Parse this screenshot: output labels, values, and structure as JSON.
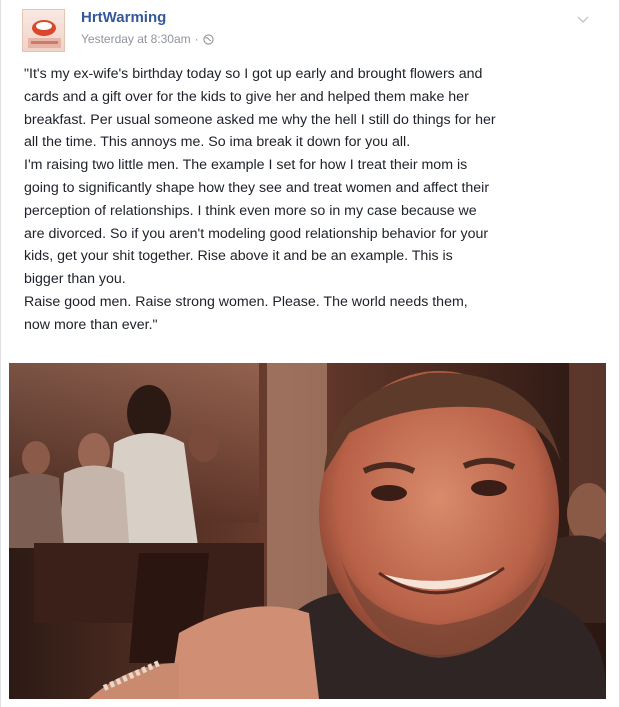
{
  "post": {
    "author": "HrtWarming",
    "timestamp": "Yesterday at 8:30am",
    "separator": "·",
    "privacy_icon": "globe-icon",
    "menu_icon": "chevron-down-icon",
    "body": "\"It's my ex-wife's birthday today so I got up early and brought flowers and\ncards and a gift over for the kids to give her and helped them make her\nbreakfast. Per usual someone asked me why the hell I still do things for her\nall the time. This annoys me. So ima break it down for you all.\nI'm raising two little men. The example I set for how I treat their mom is\ngoing to significantly shape how they see and treat women and affect their\nperception of relationships. I think even more so in my case because we\nare divorced. So if you aren't modeling good relationship behavior for your\nkids, get your shit together. Rise above it and be an example. This is\nbigger than you.\nRaise good men. Raise strong women. Please. The world needs them,\nnow more than ever.\""
  },
  "colors": {
    "author": "#365899",
    "meta": "#90949c",
    "text": "#1d2129"
  }
}
